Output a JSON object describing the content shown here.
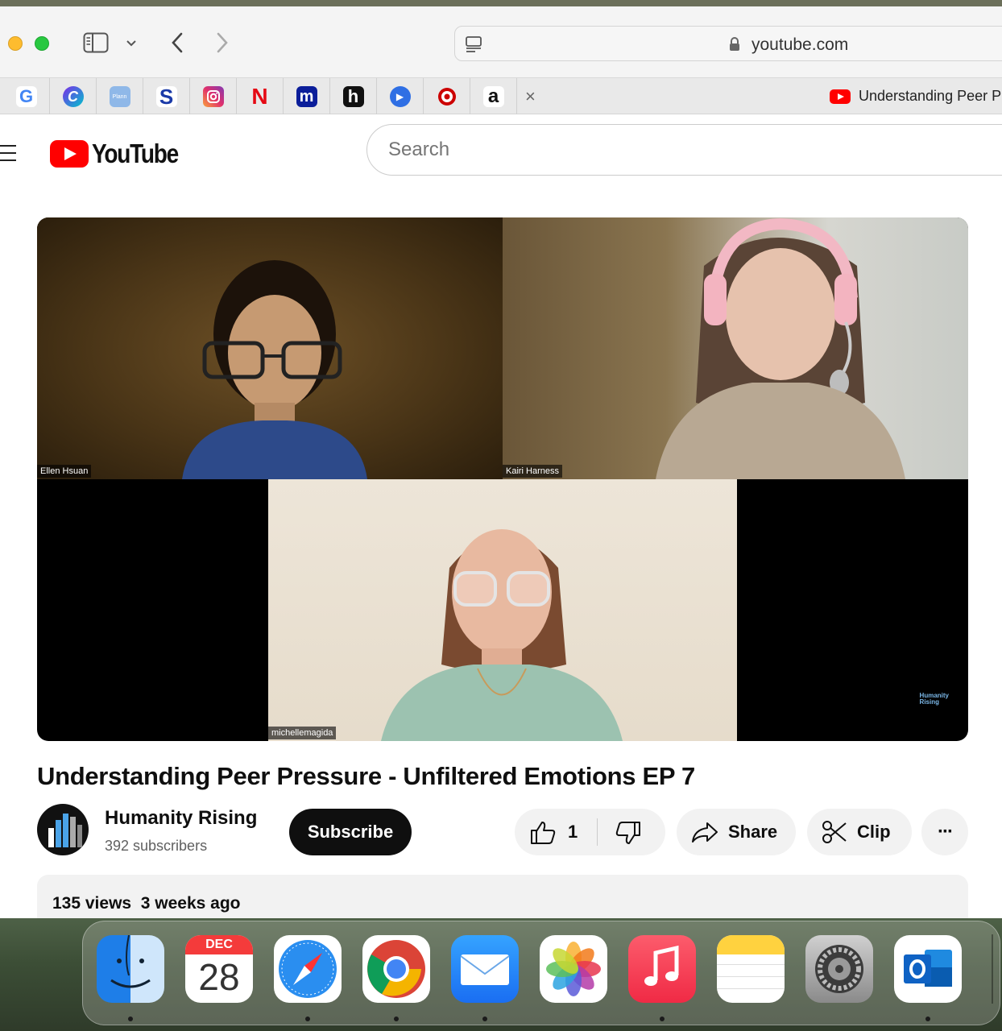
{
  "browser": {
    "address": "youtube.com",
    "favorites": [
      {
        "name": "google",
        "glyph": "G"
      },
      {
        "name": "canva",
        "glyph": "C"
      },
      {
        "name": "plann",
        "glyph": "Plann"
      },
      {
        "name": "scribd",
        "glyph": "S"
      },
      {
        "name": "instagram",
        "glyph": ""
      },
      {
        "name": "netflix",
        "glyph": "N"
      },
      {
        "name": "medium",
        "glyph": "m"
      },
      {
        "name": "hulu",
        "glyph": "h"
      },
      {
        "name": "play",
        "glyph": "▶"
      },
      {
        "name": "target",
        "glyph": ""
      },
      {
        "name": "amazon",
        "glyph": "a"
      }
    ],
    "close_glyph": "×",
    "tab_title": "Understanding Peer P"
  },
  "youtube": {
    "logo_text": "YouTube",
    "search_placeholder": "Search"
  },
  "video": {
    "participants": [
      "Ellen Hsuan",
      "Kairi Harness",
      "michellemagida"
    ],
    "watermark_line1": "Humanity",
    "watermark_line2": "Rising",
    "title": "Understanding Peer Pressure - Unfiltered Emotions EP 7"
  },
  "channel": {
    "name": "Humanity Rising",
    "subscribers": "392 subscribers",
    "subscribe_label": "Subscribe"
  },
  "actions": {
    "like_count": "1",
    "share_label": "Share",
    "clip_label": "Clip",
    "more_glyph": "···"
  },
  "description": {
    "stats": "135 views  3 weeks ago"
  },
  "dock": {
    "calendar_month": "DEC",
    "calendar_day": "28",
    "apps": [
      "finder",
      "calendar",
      "safari",
      "chrome",
      "mail",
      "photos",
      "music",
      "notes",
      "system-settings",
      "outlook"
    ]
  },
  "colors": {
    "youtube_red": "#ff0000",
    "subscribe_bg": "#0f0f0f",
    "pill_bg": "#f2f2f2"
  }
}
